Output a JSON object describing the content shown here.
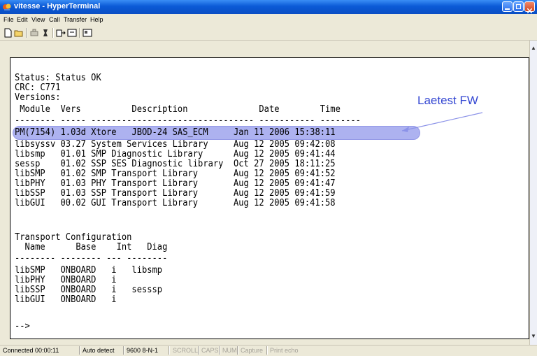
{
  "window": {
    "title": "vitesse - HyperTerminal"
  },
  "menu": [
    "File",
    "Edit",
    "View",
    "Call",
    "Transfer",
    "Help"
  ],
  "toolbar": {
    "icons": [
      "new-icon",
      "open-icon",
      "connect-icon",
      "disconnect-icon",
      "send-icon",
      "receive-icon",
      "properties-icon"
    ]
  },
  "terminal": {
    "lines": [
      "Status: Status OK",
      "CRC: C771",
      "Versions:",
      " Module  Vers          Description              Date        Time",
      "-------- ----- -------------------------------- ----------- --------",
      "PM(7154) 1.03d Xtore   JBOD-24 SAS_ECM     Jan 11 2006 15:38:11",
      "libsyssv 03.27 System Services Library     Aug 12 2005 09:42:08",
      "libsmp   01.01 SMP Diagnostic Library      Aug 12 2005 09:41:44",
      "sessp    01.02 SSP SES Diagnostic library  Oct 27 2005 18:11:25",
      "libSMP   01.02 SMP Transport Library       Aug 12 2005 09:41:52",
      "libPHY   01.03 PHY Transport Library       Aug 12 2005 09:41:47",
      "libSSP   01.03 SSP Transport Library       Aug 12 2005 09:41:59",
      "libGUI   00.02 GUI Transport Library       Aug 12 2005 09:41:58",
      "",
      "Transport Configuration",
      "  Name      Base    Int   Diag",
      "-------- -------- --- --------",
      "libSMP   ONBOARD   i   libsmp",
      "libPHY   ONBOARD   i",
      "libSSP   ONBOARD   i   sesssp",
      "libGUI   ONBOARD   i",
      "",
      "-->"
    ]
  },
  "annotation": {
    "label": "Laetest FW"
  },
  "statusbar": {
    "connected": "Connected 00:00:11",
    "detect": "Auto detect",
    "params": "9600 8-N-1",
    "scroll": "SCROLL",
    "caps": "CAPS",
    "num": "NUM",
    "capture": "Capture",
    "print": "Print echo"
  },
  "colors": {
    "highlight": "#a9aef0",
    "annotation": "#3346d2",
    "titlebar": "#0b5ad6"
  }
}
